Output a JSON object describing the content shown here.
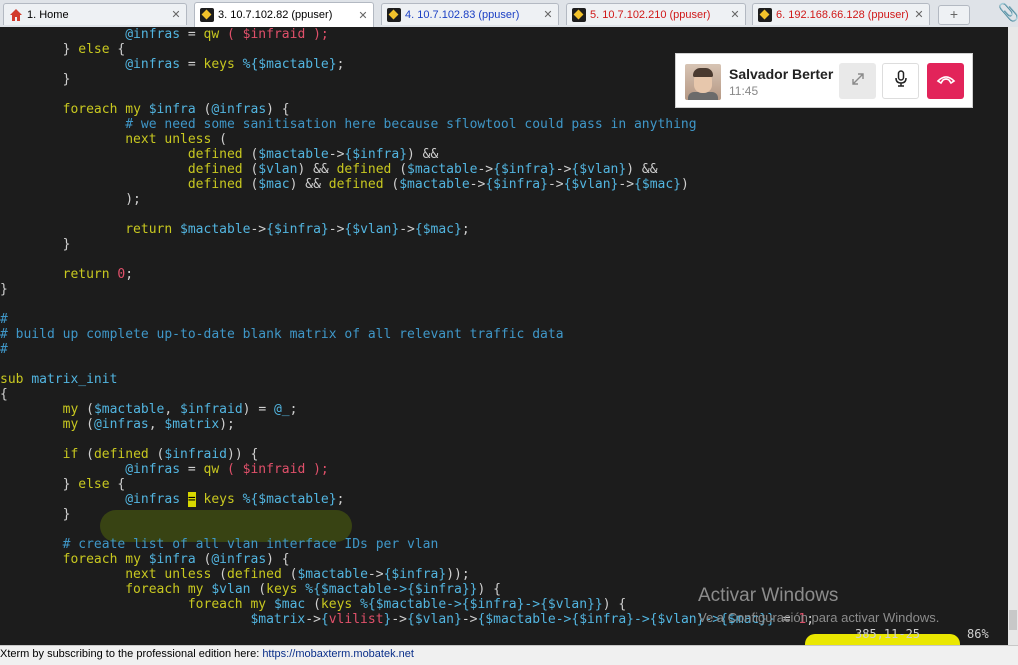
{
  "tabs": [
    {
      "label": "1. Home",
      "color": "#000000",
      "icon": "home-icon"
    },
    {
      "label": "3. 10.7.102.82 (ppuser)",
      "color": "#000000",
      "icon": "key-icon"
    },
    {
      "label": "4. 10.7.102.83 (ppuser)",
      "color": "#1a3fc4",
      "icon": "key-icon"
    },
    {
      "label": "5. 10.7.102.210 (ppuser)",
      "color": "#d01818",
      "icon": "key-icon"
    },
    {
      "label": "6. 192.168.66.128 (ppuser)",
      "color": "#d01818",
      "icon": "key-icon"
    }
  ],
  "tab_close": "✕",
  "new_tab": "+",
  "call": {
    "name": "Salvador Berter",
    "time": "11:45"
  },
  "code_lines": [
    [
      {
        "t": "\t\t",
        "c": "p"
      },
      {
        "t": "@infras",
        "c": "v"
      },
      {
        "t": " = ",
        "c": "p"
      },
      {
        "t": "qw",
        "c": "k"
      },
      {
        "t": " ( ",
        "c": "r"
      },
      {
        "t": "$infraid",
        "c": "r"
      },
      {
        "t": " );",
        "c": "r"
      }
    ],
    [
      {
        "t": "\t} ",
        "c": "p"
      },
      {
        "t": "else",
        "c": "k"
      },
      {
        "t": " {",
        "c": "p"
      }
    ],
    [
      {
        "t": "\t\t",
        "c": "p"
      },
      {
        "t": "@infras",
        "c": "v"
      },
      {
        "t": " = ",
        "c": "p"
      },
      {
        "t": "keys",
        "c": "k"
      },
      {
        "t": " ",
        "c": "p"
      },
      {
        "t": "%{$mactable}",
        "c": "v"
      },
      {
        "t": ";",
        "c": "p"
      }
    ],
    [
      {
        "t": "\t}",
        "c": "p"
      }
    ],
    [],
    [
      {
        "t": "\t",
        "c": "p"
      },
      {
        "t": "foreach",
        "c": "k"
      },
      {
        "t": " ",
        "c": "p"
      },
      {
        "t": "my",
        "c": "k"
      },
      {
        "t": " ",
        "c": "p"
      },
      {
        "t": "$infra",
        "c": "v"
      },
      {
        "t": " (",
        "c": "p"
      },
      {
        "t": "@infras",
        "c": "v"
      },
      {
        "t": ") {",
        "c": "p"
      }
    ],
    [
      {
        "t": "\t\t",
        "c": "p"
      },
      {
        "t": "# we need some sanitisation here because sflowtool could pass in anything",
        "c": "c"
      }
    ],
    [
      {
        "t": "\t\t",
        "c": "p"
      },
      {
        "t": "next",
        "c": "k"
      },
      {
        "t": " ",
        "c": "p"
      },
      {
        "t": "unless",
        "c": "k"
      },
      {
        "t": " (",
        "c": "p"
      }
    ],
    [
      {
        "t": "\t\t\t",
        "c": "p"
      },
      {
        "t": "defined",
        "c": "k"
      },
      {
        "t": " (",
        "c": "p"
      },
      {
        "t": "$mactable",
        "c": "v"
      },
      {
        "t": "->",
        "c": "p"
      },
      {
        "t": "{$infra}",
        "c": "v"
      },
      {
        "t": ") &&",
        "c": "p"
      }
    ],
    [
      {
        "t": "\t\t\t",
        "c": "p"
      },
      {
        "t": "defined",
        "c": "k"
      },
      {
        "t": " (",
        "c": "p"
      },
      {
        "t": "$vlan",
        "c": "v"
      },
      {
        "t": ") && ",
        "c": "p"
      },
      {
        "t": "defined",
        "c": "k"
      },
      {
        "t": " (",
        "c": "p"
      },
      {
        "t": "$mactable",
        "c": "v"
      },
      {
        "t": "->",
        "c": "p"
      },
      {
        "t": "{$infra}",
        "c": "v"
      },
      {
        "t": "->",
        "c": "p"
      },
      {
        "t": "{$vlan}",
        "c": "v"
      },
      {
        "t": ") &&",
        "c": "p"
      }
    ],
    [
      {
        "t": "\t\t\t",
        "c": "p"
      },
      {
        "t": "defined",
        "c": "k"
      },
      {
        "t": " (",
        "c": "p"
      },
      {
        "t": "$mac",
        "c": "v"
      },
      {
        "t": ") && ",
        "c": "p"
      },
      {
        "t": "defined",
        "c": "k"
      },
      {
        "t": " (",
        "c": "p"
      },
      {
        "t": "$mactable",
        "c": "v"
      },
      {
        "t": "->",
        "c": "p"
      },
      {
        "t": "{$infra}",
        "c": "v"
      },
      {
        "t": "->",
        "c": "p"
      },
      {
        "t": "{$vlan}",
        "c": "v"
      },
      {
        "t": "->",
        "c": "p"
      },
      {
        "t": "{$mac}",
        "c": "v"
      },
      {
        "t": ")",
        "c": "p"
      }
    ],
    [
      {
        "t": "\t\t);",
        "c": "p"
      }
    ],
    [],
    [
      {
        "t": "\t\t",
        "c": "p"
      },
      {
        "t": "return",
        "c": "k"
      },
      {
        "t": " ",
        "c": "p"
      },
      {
        "t": "$mactable",
        "c": "v"
      },
      {
        "t": "->",
        "c": "p"
      },
      {
        "t": "{$infra}",
        "c": "v"
      },
      {
        "t": "->",
        "c": "p"
      },
      {
        "t": "{$vlan}",
        "c": "v"
      },
      {
        "t": "->",
        "c": "p"
      },
      {
        "t": "{$mac}",
        "c": "v"
      },
      {
        "t": ";",
        "c": "p"
      }
    ],
    [
      {
        "t": "\t}",
        "c": "p"
      }
    ],
    [],
    [
      {
        "t": "\t",
        "c": "p"
      },
      {
        "t": "return",
        "c": "k"
      },
      {
        "t": " ",
        "c": "p"
      },
      {
        "t": "0",
        "c": "r"
      },
      {
        "t": ";",
        "c": "p"
      }
    ],
    [
      {
        "t": "}",
        "c": "p"
      }
    ],
    [],
    [
      {
        "t": "#",
        "c": "c"
      }
    ],
    [
      {
        "t": "# build up complete up-to-date blank matrix of all relevant traffic data",
        "c": "c"
      }
    ],
    [
      {
        "t": "#",
        "c": "c"
      }
    ],
    [],
    [
      {
        "t": "sub",
        "c": "k"
      },
      {
        "t": " ",
        "c": "p"
      },
      {
        "t": "matrix_init",
        "c": "v"
      }
    ],
    [
      {
        "t": "{",
        "c": "p"
      }
    ],
    [
      {
        "t": "\t",
        "c": "p"
      },
      {
        "t": "my",
        "c": "k"
      },
      {
        "t": " (",
        "c": "p"
      },
      {
        "t": "$mactable",
        "c": "v"
      },
      {
        "t": ", ",
        "c": "p"
      },
      {
        "t": "$infraid",
        "c": "v"
      },
      {
        "t": ") = ",
        "c": "p"
      },
      {
        "t": "@_",
        "c": "v"
      },
      {
        "t": ";",
        "c": "p"
      }
    ],
    [
      {
        "t": "\t",
        "c": "p"
      },
      {
        "t": "my",
        "c": "k"
      },
      {
        "t": " (",
        "c": "p"
      },
      {
        "t": "@infras",
        "c": "v"
      },
      {
        "t": ", ",
        "c": "p"
      },
      {
        "t": "$matrix",
        "c": "v"
      },
      {
        "t": ");",
        "c": "p"
      }
    ],
    [],
    [
      {
        "t": "\t",
        "c": "p"
      },
      {
        "t": "if",
        "c": "k"
      },
      {
        "t": " (",
        "c": "p"
      },
      {
        "t": "defined",
        "c": "k"
      },
      {
        "t": " (",
        "c": "p"
      },
      {
        "t": "$infraid",
        "c": "v"
      },
      {
        "t": ")) {",
        "c": "p"
      }
    ],
    [
      {
        "t": "\t\t",
        "c": "p"
      },
      {
        "t": "@infras",
        "c": "v"
      },
      {
        "t": " = ",
        "c": "p"
      },
      {
        "t": "qw",
        "c": "k"
      },
      {
        "t": " ( ",
        "c": "r"
      },
      {
        "t": "$infraid",
        "c": "r"
      },
      {
        "t": " );",
        "c": "r"
      }
    ],
    [
      {
        "t": "\t} ",
        "c": "p"
      },
      {
        "t": "else",
        "c": "k"
      },
      {
        "t": " {",
        "c": "p"
      }
    ],
    [
      {
        "t": "\t\t",
        "c": "p"
      },
      {
        "t": "@infras",
        "c": "v"
      },
      {
        "t": " ",
        "c": "p"
      },
      {
        "t": "=",
        "c": "cursor"
      },
      {
        "t": " ",
        "c": "p"
      },
      {
        "t": "keys",
        "c": "k"
      },
      {
        "t": " ",
        "c": "p"
      },
      {
        "t": "%{$mactable}",
        "c": "v"
      },
      {
        "t": ";",
        "c": "p"
      }
    ],
    [
      {
        "t": "\t}",
        "c": "p"
      }
    ],
    [],
    [
      {
        "t": "\t",
        "c": "p"
      },
      {
        "t": "# create list of all vlan interface IDs per vlan",
        "c": "c"
      }
    ],
    [
      {
        "t": "\t",
        "c": "p"
      },
      {
        "t": "foreach",
        "c": "k"
      },
      {
        "t": " ",
        "c": "p"
      },
      {
        "t": "my",
        "c": "k"
      },
      {
        "t": " ",
        "c": "p"
      },
      {
        "t": "$infra",
        "c": "v"
      },
      {
        "t": " (",
        "c": "p"
      },
      {
        "t": "@infras",
        "c": "v"
      },
      {
        "t": ") {",
        "c": "p"
      }
    ],
    [
      {
        "t": "\t\t",
        "c": "p"
      },
      {
        "t": "next",
        "c": "k"
      },
      {
        "t": " ",
        "c": "p"
      },
      {
        "t": "unless",
        "c": "k"
      },
      {
        "t": " (",
        "c": "p"
      },
      {
        "t": "defined",
        "c": "k"
      },
      {
        "t": " (",
        "c": "p"
      },
      {
        "t": "$mactable",
        "c": "v"
      },
      {
        "t": "->",
        "c": "p"
      },
      {
        "t": "{$infra}",
        "c": "v"
      },
      {
        "t": "));",
        "c": "p"
      }
    ],
    [
      {
        "t": "\t\t",
        "c": "p"
      },
      {
        "t": "foreach",
        "c": "k"
      },
      {
        "t": " ",
        "c": "p"
      },
      {
        "t": "my",
        "c": "k"
      },
      {
        "t": " ",
        "c": "p"
      },
      {
        "t": "$vlan",
        "c": "v"
      },
      {
        "t": " (",
        "c": "p"
      },
      {
        "t": "keys",
        "c": "k"
      },
      {
        "t": " ",
        "c": "p"
      },
      {
        "t": "%{$mactable->{$infra}}",
        "c": "v"
      },
      {
        "t": ") {",
        "c": "p"
      }
    ],
    [
      {
        "t": "\t\t\t",
        "c": "p"
      },
      {
        "t": "foreach",
        "c": "k"
      },
      {
        "t": " ",
        "c": "p"
      },
      {
        "t": "my",
        "c": "k"
      },
      {
        "t": " ",
        "c": "p"
      },
      {
        "t": "$mac",
        "c": "v"
      },
      {
        "t": " (",
        "c": "p"
      },
      {
        "t": "keys",
        "c": "k"
      },
      {
        "t": " ",
        "c": "p"
      },
      {
        "t": "%{$mactable->{$infra}->{$vlan}}",
        "c": "v"
      },
      {
        "t": ") {",
        "c": "p"
      }
    ],
    [
      {
        "t": "\t\t\t\t",
        "c": "p"
      },
      {
        "t": "$matrix",
        "c": "v"
      },
      {
        "t": "->",
        "c": "p"
      },
      {
        "t": "{",
        "c": "v"
      },
      {
        "t": "vlilist",
        "c": "r"
      },
      {
        "t": "}",
        "c": "v"
      },
      {
        "t": "->",
        "c": "p"
      },
      {
        "t": "{$vlan}",
        "c": "v"
      },
      {
        "t": "->",
        "c": "p"
      },
      {
        "t": "{$mactable->{$infra}->{$vlan}->{$mac}}",
        "c": "v"
      },
      {
        "t": " = ",
        "c": "p"
      },
      {
        "t": "1",
        "c": "r"
      },
      {
        "t": ";",
        "c": "p"
      }
    ]
  ],
  "status": {
    "position": "385,11-25",
    "percent": "86%"
  },
  "watermark": {
    "line1": "Activar Windows",
    "line2": "Ve a Configuración para activar Windows."
  },
  "footer": {
    "text": "Xterm by subscribing to the professional edition here: ",
    "link": "https://mobaxterm.mobatek.net"
  },
  "colors": {
    "terminal_bg": "#1c1c1c",
    "keyword": "#c8c820",
    "variable": "#52b5e0",
    "comment": "#3f97c8",
    "string": "#e0506a",
    "hangup": "#e2245a"
  }
}
